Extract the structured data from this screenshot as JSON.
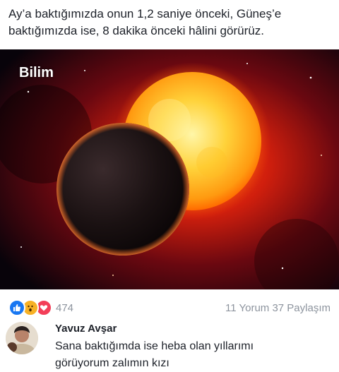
{
  "post": {
    "text_line1": "Ay’a baktığımızda onun 1,2 saniye önceki, Güneş’e",
    "text_line2": "baktığımızda ise, 8 dakika önceki hâlini görürüz."
  },
  "image": {
    "watermark": "Bilim"
  },
  "stats": {
    "reaction_icons": [
      "like-icon",
      "wow-icon",
      "love-icon"
    ],
    "reaction_count": "474",
    "comments_shares": "11 Yorum 37 Paylaşım"
  },
  "comment": {
    "author": "Yavuz Avşar",
    "text_line1": "Sana baktığımda ise heba olan yıllarımı",
    "text_line2": "görüyorum zalımın kızı"
  },
  "colors": {
    "like": "#1877f2",
    "wow": "#f7b125",
    "love": "#f33e58",
    "text": "#1d2129",
    "meta": "#8d949e"
  }
}
